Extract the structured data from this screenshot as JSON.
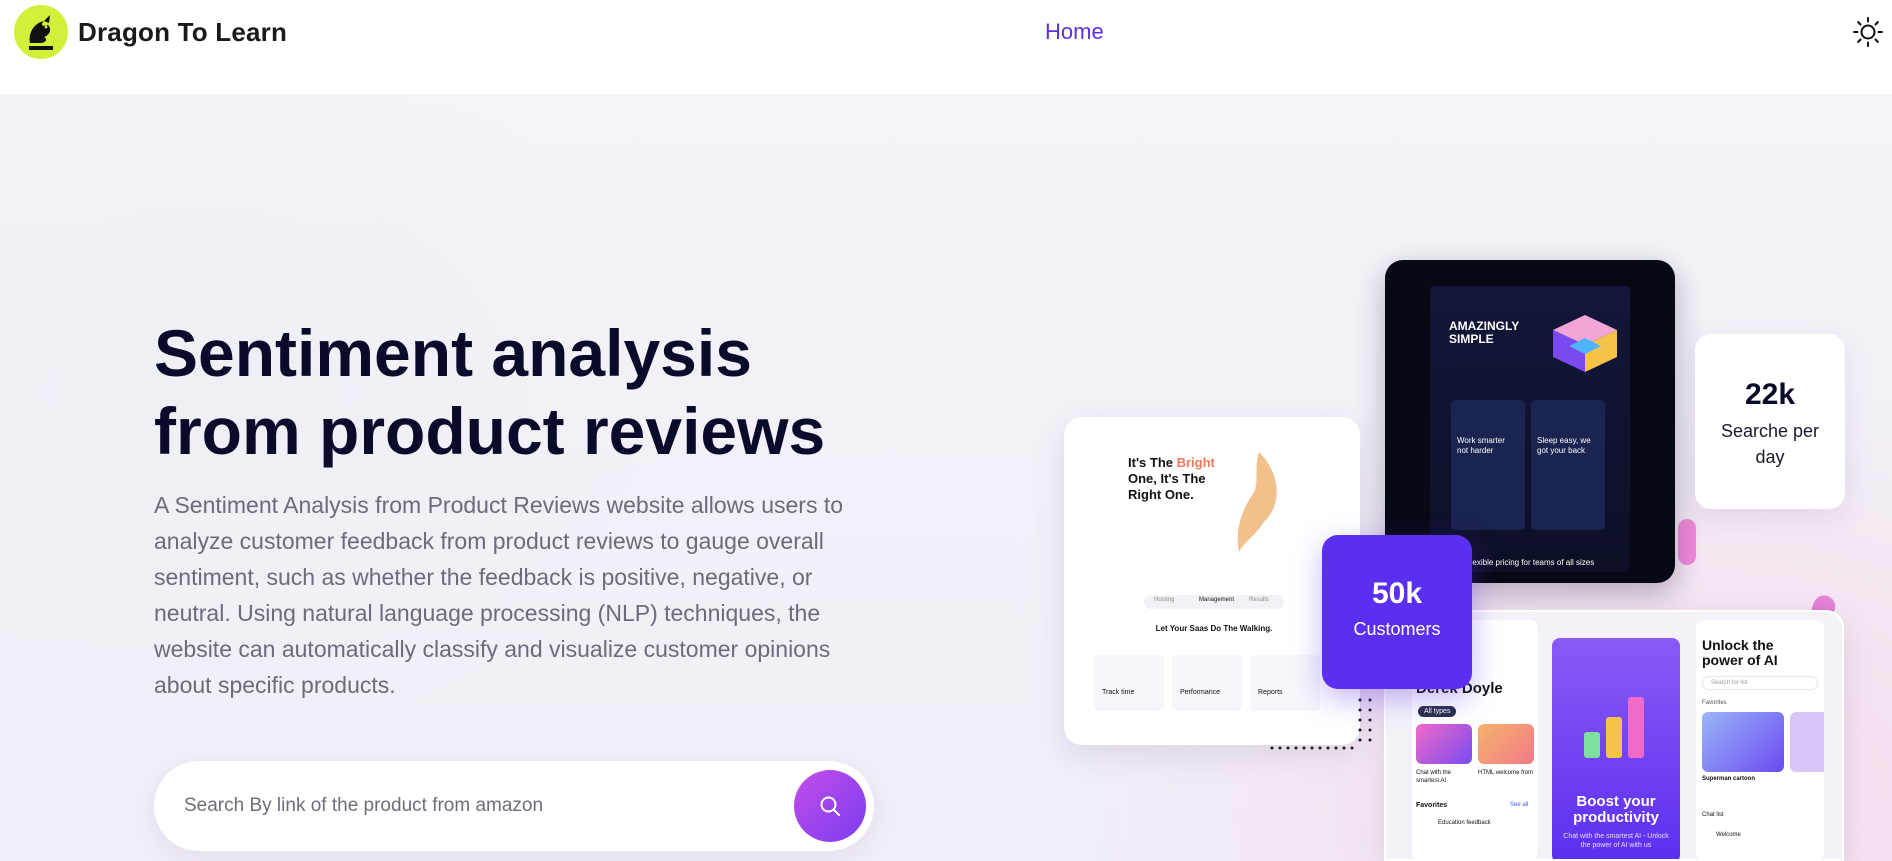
{
  "header": {
    "brand_name": "Dragon To Learn",
    "logo_text": "DRAGON",
    "nav_home": "Home",
    "theme_icon": "sun-icon"
  },
  "hero": {
    "title_line1": "Sentiment analysis",
    "title_line2": "from product reviews",
    "description": "A Sentiment Analysis from Product Reviews website allows users to analyze customer feedback from product reviews to gauge overall sentiment, such as whether the feedback is positive, negative, or neutral. Using natural language processing (NLP) techniques, the website can automatically classify and visualize customer opinions about specific products.",
    "search_placeholder": "Search By link of the product from amazon",
    "search_icon": "search-icon"
  },
  "stats": [
    {
      "value": "22k",
      "label": "Searche per day"
    },
    {
      "value": "50k",
      "label": "Customers"
    }
  ],
  "showcase": {
    "light_card": {
      "heading_pre": "It's The ",
      "heading_accent": "Bright",
      "heading_post": " One, It's The Right One.",
      "tabs": [
        "Hosting",
        "Management",
        "Results"
      ],
      "section_title": "Let Your Saas Do The Walking.",
      "features": [
        "Track time",
        "Performance",
        "Reports"
      ]
    },
    "dark_card": {
      "heading": "AMAZINGLY SIMPLE",
      "box1": "Work smarter not harder",
      "box2": "Sleep easy, we got your back",
      "footer": "Flexible pricing for teams of all sizes"
    },
    "app_card": {
      "name": "Derek Doyle",
      "chip": "All types",
      "item1": "Chat with the smartest AI",
      "item2": "HTML welcome from",
      "favorites": "Favorites",
      "see_all": "See all",
      "fav_item": "Education feedback",
      "promo_title": "Boost your productivity",
      "promo_sub": "Chat with the smartest AI - Unlock the power of AI with us",
      "right_title": "Unlock the power of AI",
      "right_search": "Search for list",
      "right_fav": "Favorites",
      "right_item": "Superman cartoon",
      "chat_list": "Chat list",
      "welcome": "Welcome"
    }
  },
  "colors": {
    "accent": "#5a2fe6",
    "stat_purple": "#5b2ff0",
    "logo_yellow": "#d4ef3a",
    "title_dark": "#0a0a2a"
  }
}
